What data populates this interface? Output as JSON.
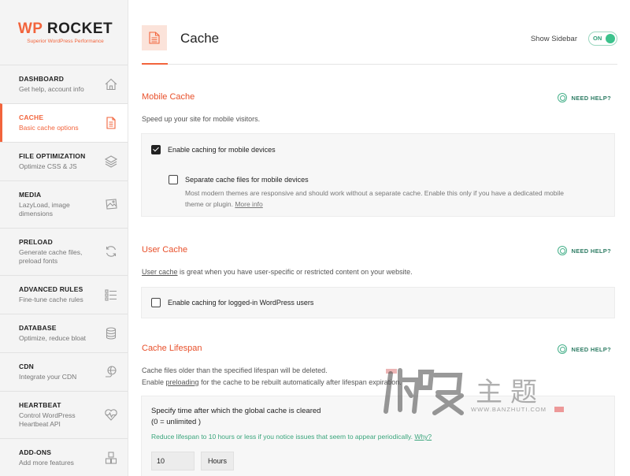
{
  "logo": {
    "wp": "WP",
    "rocket": " ROCKET",
    "tagline": "Superior WordPress Performance"
  },
  "sidebar": {
    "items": [
      {
        "title": "DASHBOARD",
        "desc": "Get help, account info",
        "icon": "home-icon"
      },
      {
        "title": "CACHE",
        "desc": "Basic cache options",
        "icon": "document-icon"
      },
      {
        "title": "FILE OPTIMIZATION",
        "desc": "Optimize CSS & JS",
        "icon": "layers-icon"
      },
      {
        "title": "MEDIA",
        "desc": "LazyLoad, image dimensions",
        "icon": "image-icon"
      },
      {
        "title": "PRELOAD",
        "desc": "Generate cache files, preload fonts",
        "icon": "refresh-icon"
      },
      {
        "title": "ADVANCED RULES",
        "desc": "Fine-tune cache rules",
        "icon": "list-icon"
      },
      {
        "title": "DATABASE",
        "desc": "Optimize, reduce bloat",
        "icon": "database-icon"
      },
      {
        "title": "CDN",
        "desc": "Integrate your CDN",
        "icon": "cdn-icon"
      },
      {
        "title": "HEARTBEAT",
        "desc": "Control WordPress Heartbeat API",
        "icon": "heartbeat-icon"
      },
      {
        "title": "ADD-ONS",
        "desc": "Add more features",
        "icon": "addons-icon"
      }
    ]
  },
  "header": {
    "title": "Cache",
    "show_sidebar_label": "Show Sidebar",
    "toggle_state": "ON"
  },
  "help_label": "NEED HELP?",
  "mobile_cache": {
    "title": "Mobile Cache",
    "desc": "Speed up your site for mobile visitors.",
    "enable_label": "Enable caching for mobile devices",
    "enable_checked": true,
    "separate_label": "Separate cache files for mobile devices",
    "separate_checked": false,
    "separate_desc_1": "Most modern themes are responsive and should work without a separate cache. Enable this only if you have a dedicated mobile",
    "separate_desc_2": "theme or plugin.",
    "more_info": "More info"
  },
  "user_cache": {
    "title": "User Cache",
    "desc_link": "User cache",
    "desc_rest": " is great when you have user-specific or restricted content on your website.",
    "enable_label": "Enable caching for logged-in WordPress users",
    "enable_checked": false
  },
  "cache_lifespan": {
    "title": "Cache Lifespan",
    "desc_1": "Cache files older than the specified lifespan will be deleted.",
    "desc_2_pre": "Enable ",
    "desc_2_link": "preloading",
    "desc_2_post": " for the cache to be rebuilt automatically after lifespan expiration.",
    "field_label_1": "Specify time after which the global cache is cleared",
    "field_label_2": "(0 = unlimited )",
    "warning": "Reduce lifespan to 10 hours or less if you notice issues that seem to appear periodically.",
    "warning_link": "Why?",
    "value": "10",
    "unit": "Hours"
  },
  "watermark": {
    "text": "主题",
    "url": "WWW.BANZHUTI.COM"
  },
  "colors": {
    "accent": "#f2643c",
    "help": "#2f7d65",
    "toggle": "#3cc28c"
  }
}
